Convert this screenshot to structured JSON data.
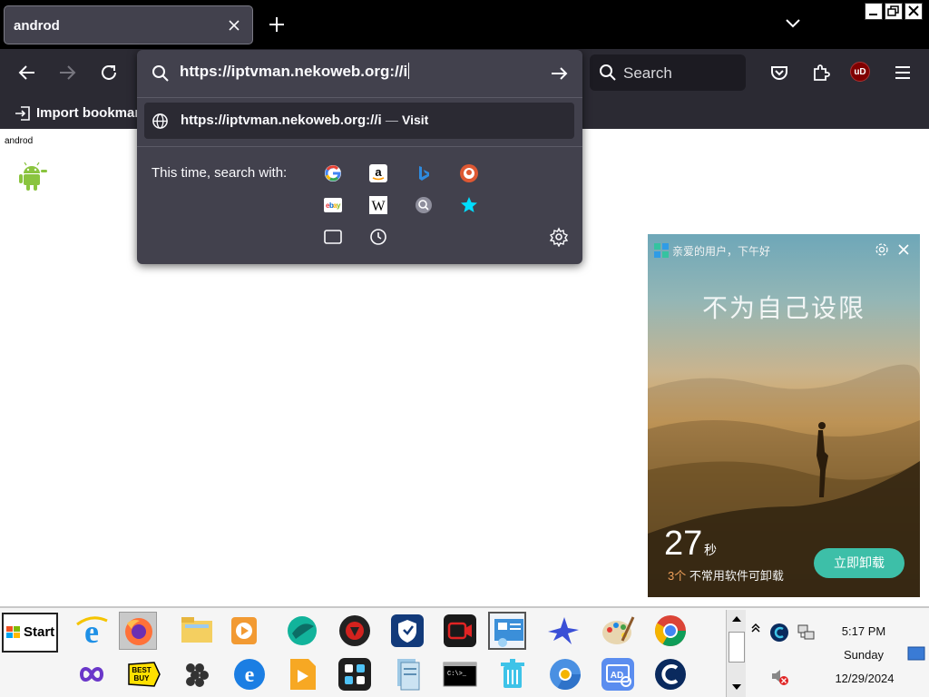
{
  "browser": {
    "tab": {
      "title": "androd"
    },
    "search_box": {
      "placeholder": "Search"
    },
    "ublock_label": "uD",
    "bookmarks": {
      "import_label": "Import bookmarks..."
    }
  },
  "urlbar": {
    "input_value": "https://iptvman.nekoweb.org://i",
    "result": {
      "url": "https://iptvman.nekoweb.org://i",
      "separator": "—",
      "action": "Visit"
    },
    "oneoff_label": "This time, search with:",
    "engines": [
      "Google",
      "Amazon",
      "Bing",
      "DuckDuckGo",
      "eBay",
      "Wikipedia",
      "Other search",
      "Bookmarks",
      "Tabs",
      "History"
    ]
  },
  "page": {
    "title": "androd"
  },
  "ad": {
    "greeting": "亲爱的用户，下午好",
    "slogan": "不为自己设限",
    "countdown": "27",
    "countdown_unit": "秒",
    "info_count": "3个",
    "info_text": " 不常用软件可卸载",
    "button": "立即卸载"
  },
  "taskbar": {
    "start_label": "Start",
    "apps": [
      "Internet Explorer",
      "Firefox",
      "File Explorer",
      "Media Player",
      "Browser",
      "Antivirus",
      "Security",
      "Screen Recorder",
      "Control Panel",
      "Bird app",
      "Paint",
      "Chrome",
      "Infinity",
      "Best Buy",
      "Grapes",
      "Edge",
      "Player",
      "Windows app",
      "Registry",
      "Command Prompt",
      "Recycle Bin",
      "Chromium",
      "Ad blocker",
      "CCleaner"
    ],
    "clock": {
      "time": "5:17 PM",
      "day": "Sunday",
      "date": "12/29/2024"
    }
  },
  "colors": {
    "toolbar": "#2b2a33",
    "popup": "#42414d",
    "accent_ad_button": "#3dbfa8"
  }
}
